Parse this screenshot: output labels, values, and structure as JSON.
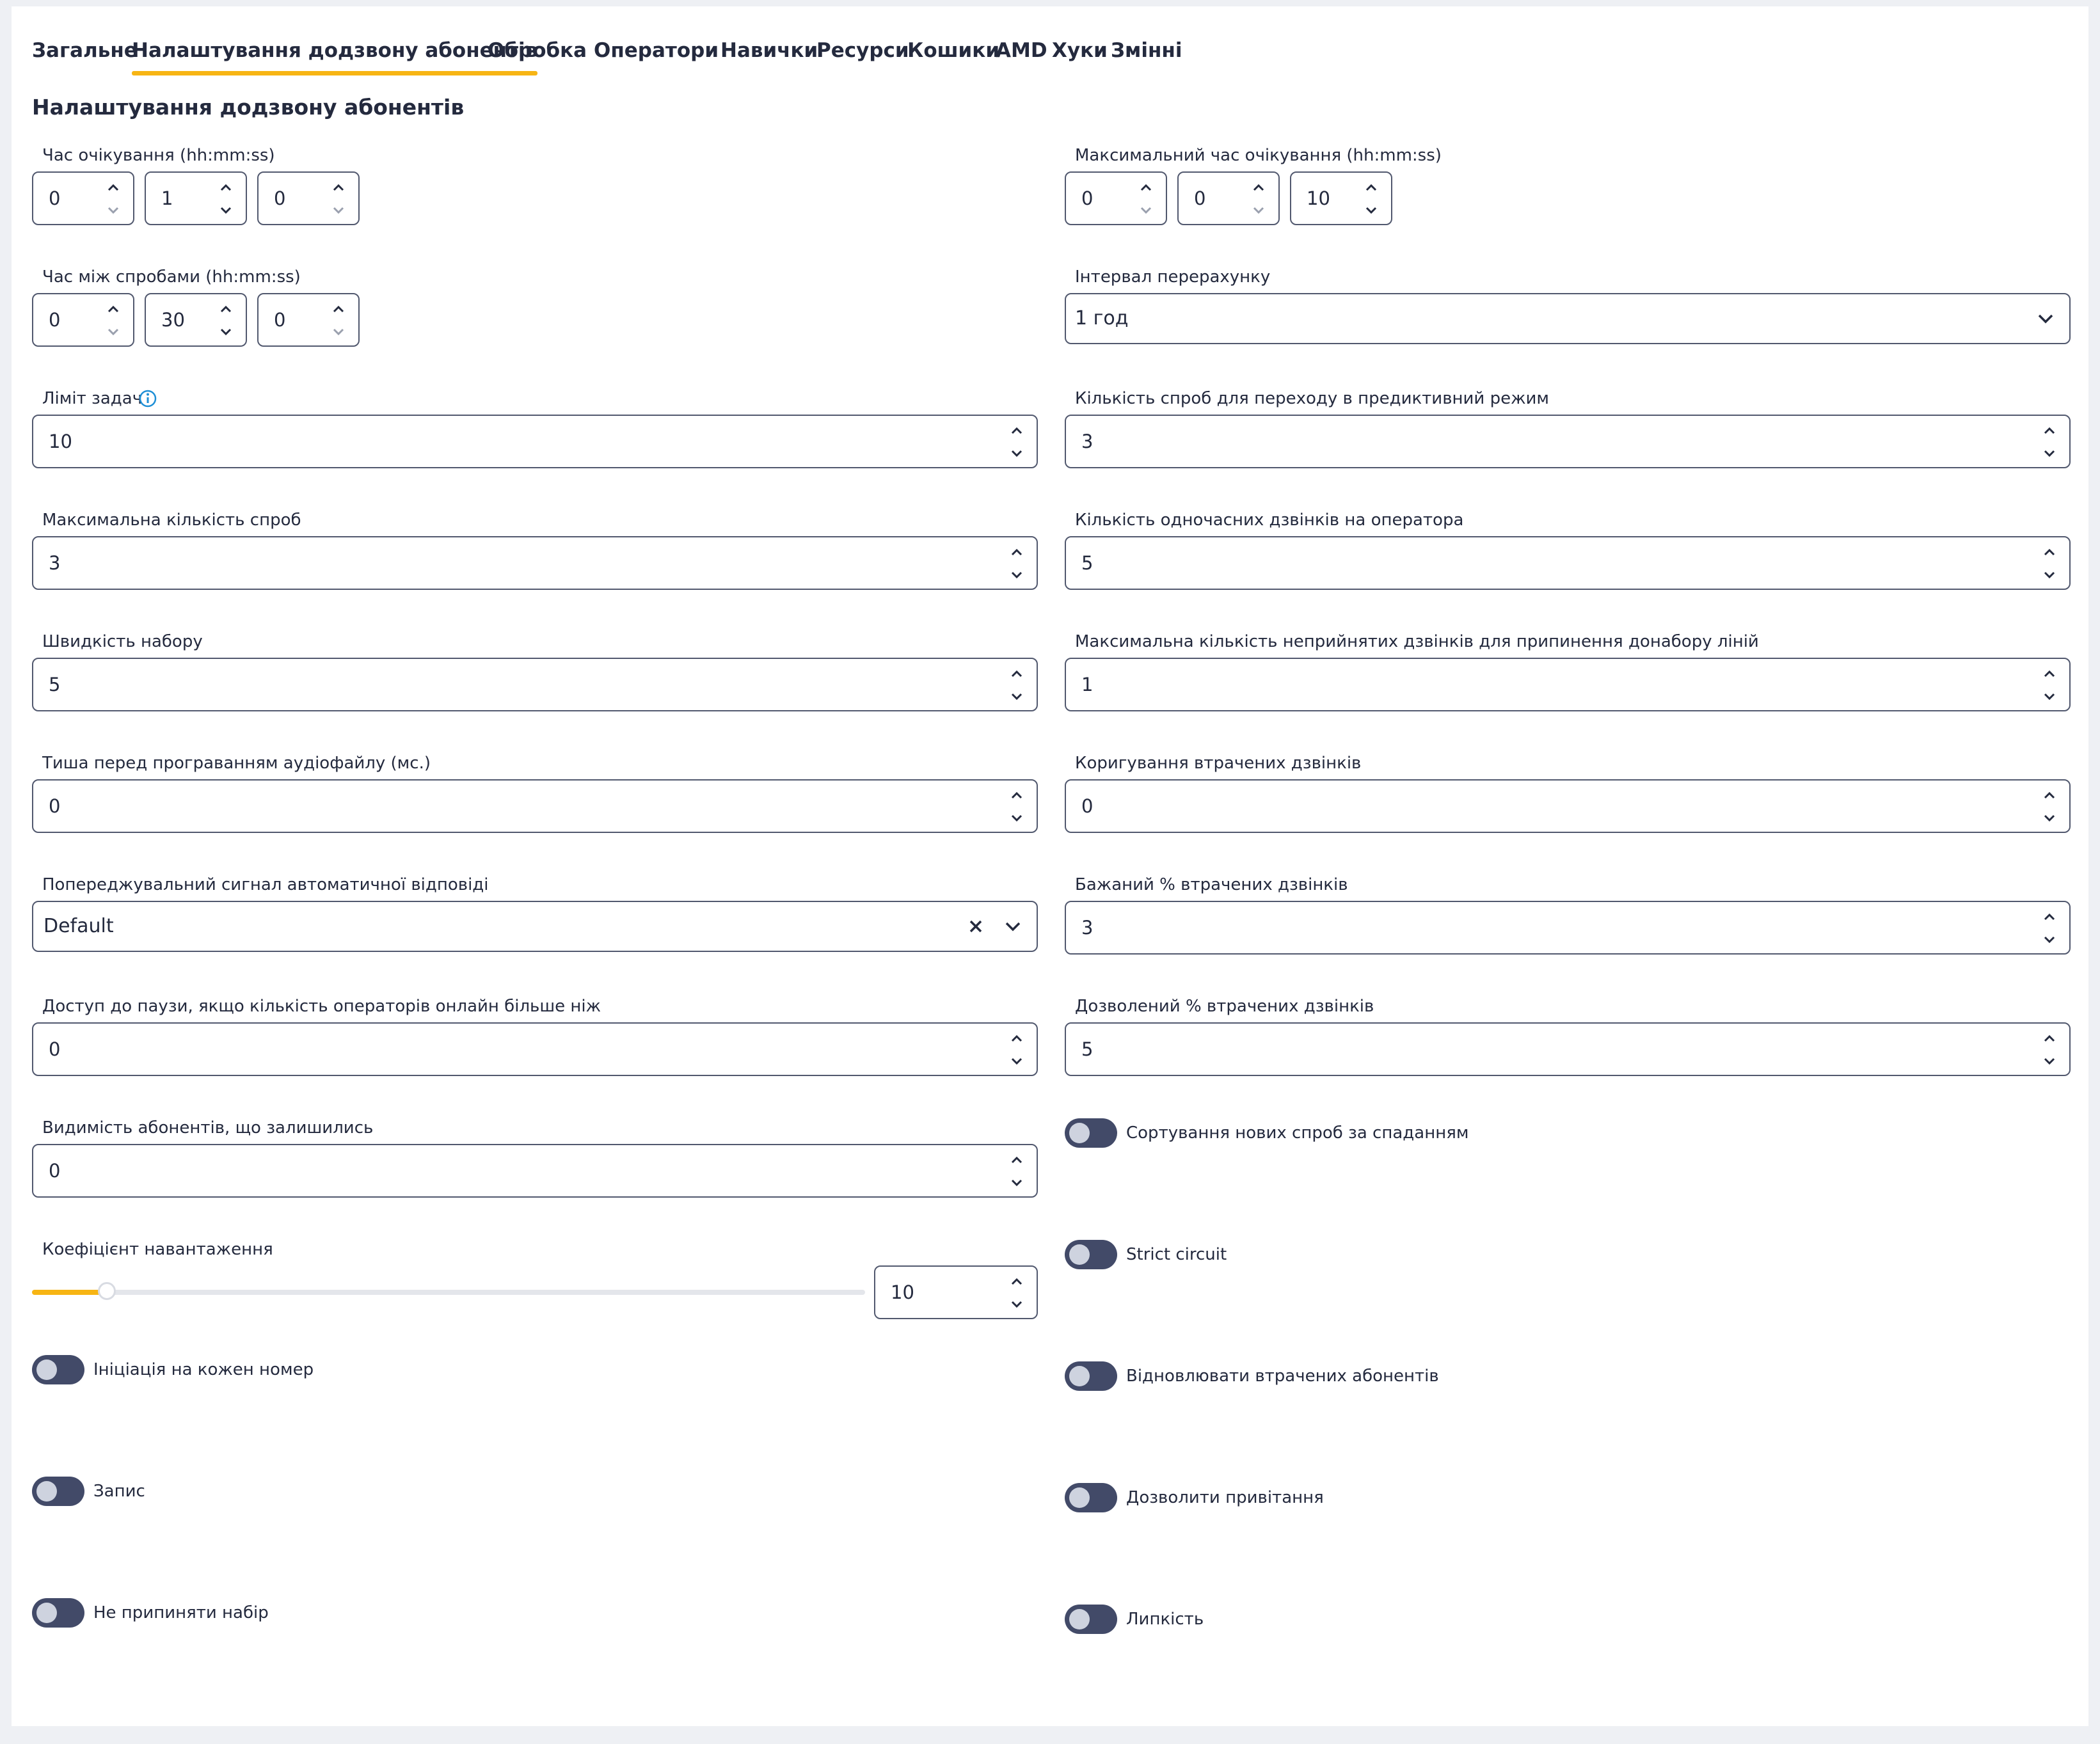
{
  "tabs": [
    {
      "label": "Загальне",
      "active": false
    },
    {
      "label": "Налаштування додзвону абонентів",
      "active": true
    },
    {
      "label": "Обробка",
      "active": false
    },
    {
      "label": "Оператори",
      "active": false
    },
    {
      "label": "Навички",
      "active": false
    },
    {
      "label": "Ресурси",
      "active": false
    },
    {
      "label": "Кошики",
      "active": false
    },
    {
      "label": "AMD",
      "active": false
    },
    {
      "label": "Хуки",
      "active": false
    },
    {
      "label": "Змінні",
      "active": false
    }
  ],
  "section_title": "Налаштування додзвону абонентів",
  "left": {
    "wait_time": {
      "label": "Час очікування (hh:mm:ss)",
      "hh": "0",
      "mm": "1",
      "ss": "0"
    },
    "retry_time": {
      "label": "Час між спробами (hh:mm:ss)",
      "hh": "0",
      "mm": "30",
      "ss": "0"
    },
    "task_limit": {
      "label": "Ліміт задач",
      "value": "10"
    },
    "max_attempts": {
      "label": "Максимальна кількість спроб",
      "value": "3"
    },
    "dial_speed": {
      "label": "Швидкість набору",
      "value": "5"
    },
    "silence": {
      "label": "Тиша перед програванням аудіофайлу (мс.)",
      "value": "0"
    },
    "beep_signal": {
      "label": "Попереджувальний сигнал автоматичної відповіді",
      "value": "Default"
    },
    "pause_access": {
      "label": "Доступ до паузи, якщо кількість операторів онлайн більше ніж",
      "value": "0"
    },
    "remaining_visibility": {
      "label": "Видимість абонентів, що залишились",
      "value": "0"
    },
    "load_factor": {
      "label": "Коефіцієнт навантаження",
      "value": "10",
      "slider_fraction": 0.09
    },
    "init_each_number": {
      "label": "Ініціація на кожен номер",
      "on": false
    },
    "record": {
      "label": "Запис",
      "on": false
    },
    "dont_stop_dialing": {
      "label": "Не припиняти набір",
      "on": false
    }
  },
  "right": {
    "max_wait_time": {
      "label": "Максимальний час очікування (hh:mm:ss)",
      "hh": "0",
      "mm": "0",
      "ss": "10"
    },
    "recalc_interval": {
      "label": "Інтервал перерахунку",
      "value": "1 год"
    },
    "predictive_attempts": {
      "label": "Кількість спроб для переходу в предиктивний режим",
      "value": "3"
    },
    "concurrent_calls": {
      "label": "Кількість одночасних дзвінків на оператора",
      "value": "5"
    },
    "max_unanswered": {
      "label": "Максимальна кількість неприйнятих дзвінків для припинення донабору ліній",
      "value": "1"
    },
    "lost_correction": {
      "label": "Коригування втрачених дзвінків",
      "value": "0"
    },
    "desired_lost": {
      "label": "Бажаний % втрачених дзвінків",
      "value": "3"
    },
    "allowed_lost": {
      "label": "Дозволений % втрачених дзвінків",
      "value": "5"
    },
    "sort_desc": {
      "label": "Сортування нових спроб за спаданням",
      "on": false
    },
    "strict_circuit": {
      "label": "Strict circuit",
      "on": false
    },
    "restore_lost": {
      "label": "Відновлювати втрачених абонентів",
      "on": false
    },
    "allow_greeting": {
      "label": "Дозволити привітання",
      "on": false
    },
    "stickiness": {
      "label": "Липкість",
      "on": false
    }
  },
  "colors": {
    "accent": "#f7b514",
    "text": "#242a3e",
    "border": "#51586e",
    "toggle_off": "#424a68",
    "info_icon": "#1e8fd6",
    "background": "#eef0f4"
  }
}
